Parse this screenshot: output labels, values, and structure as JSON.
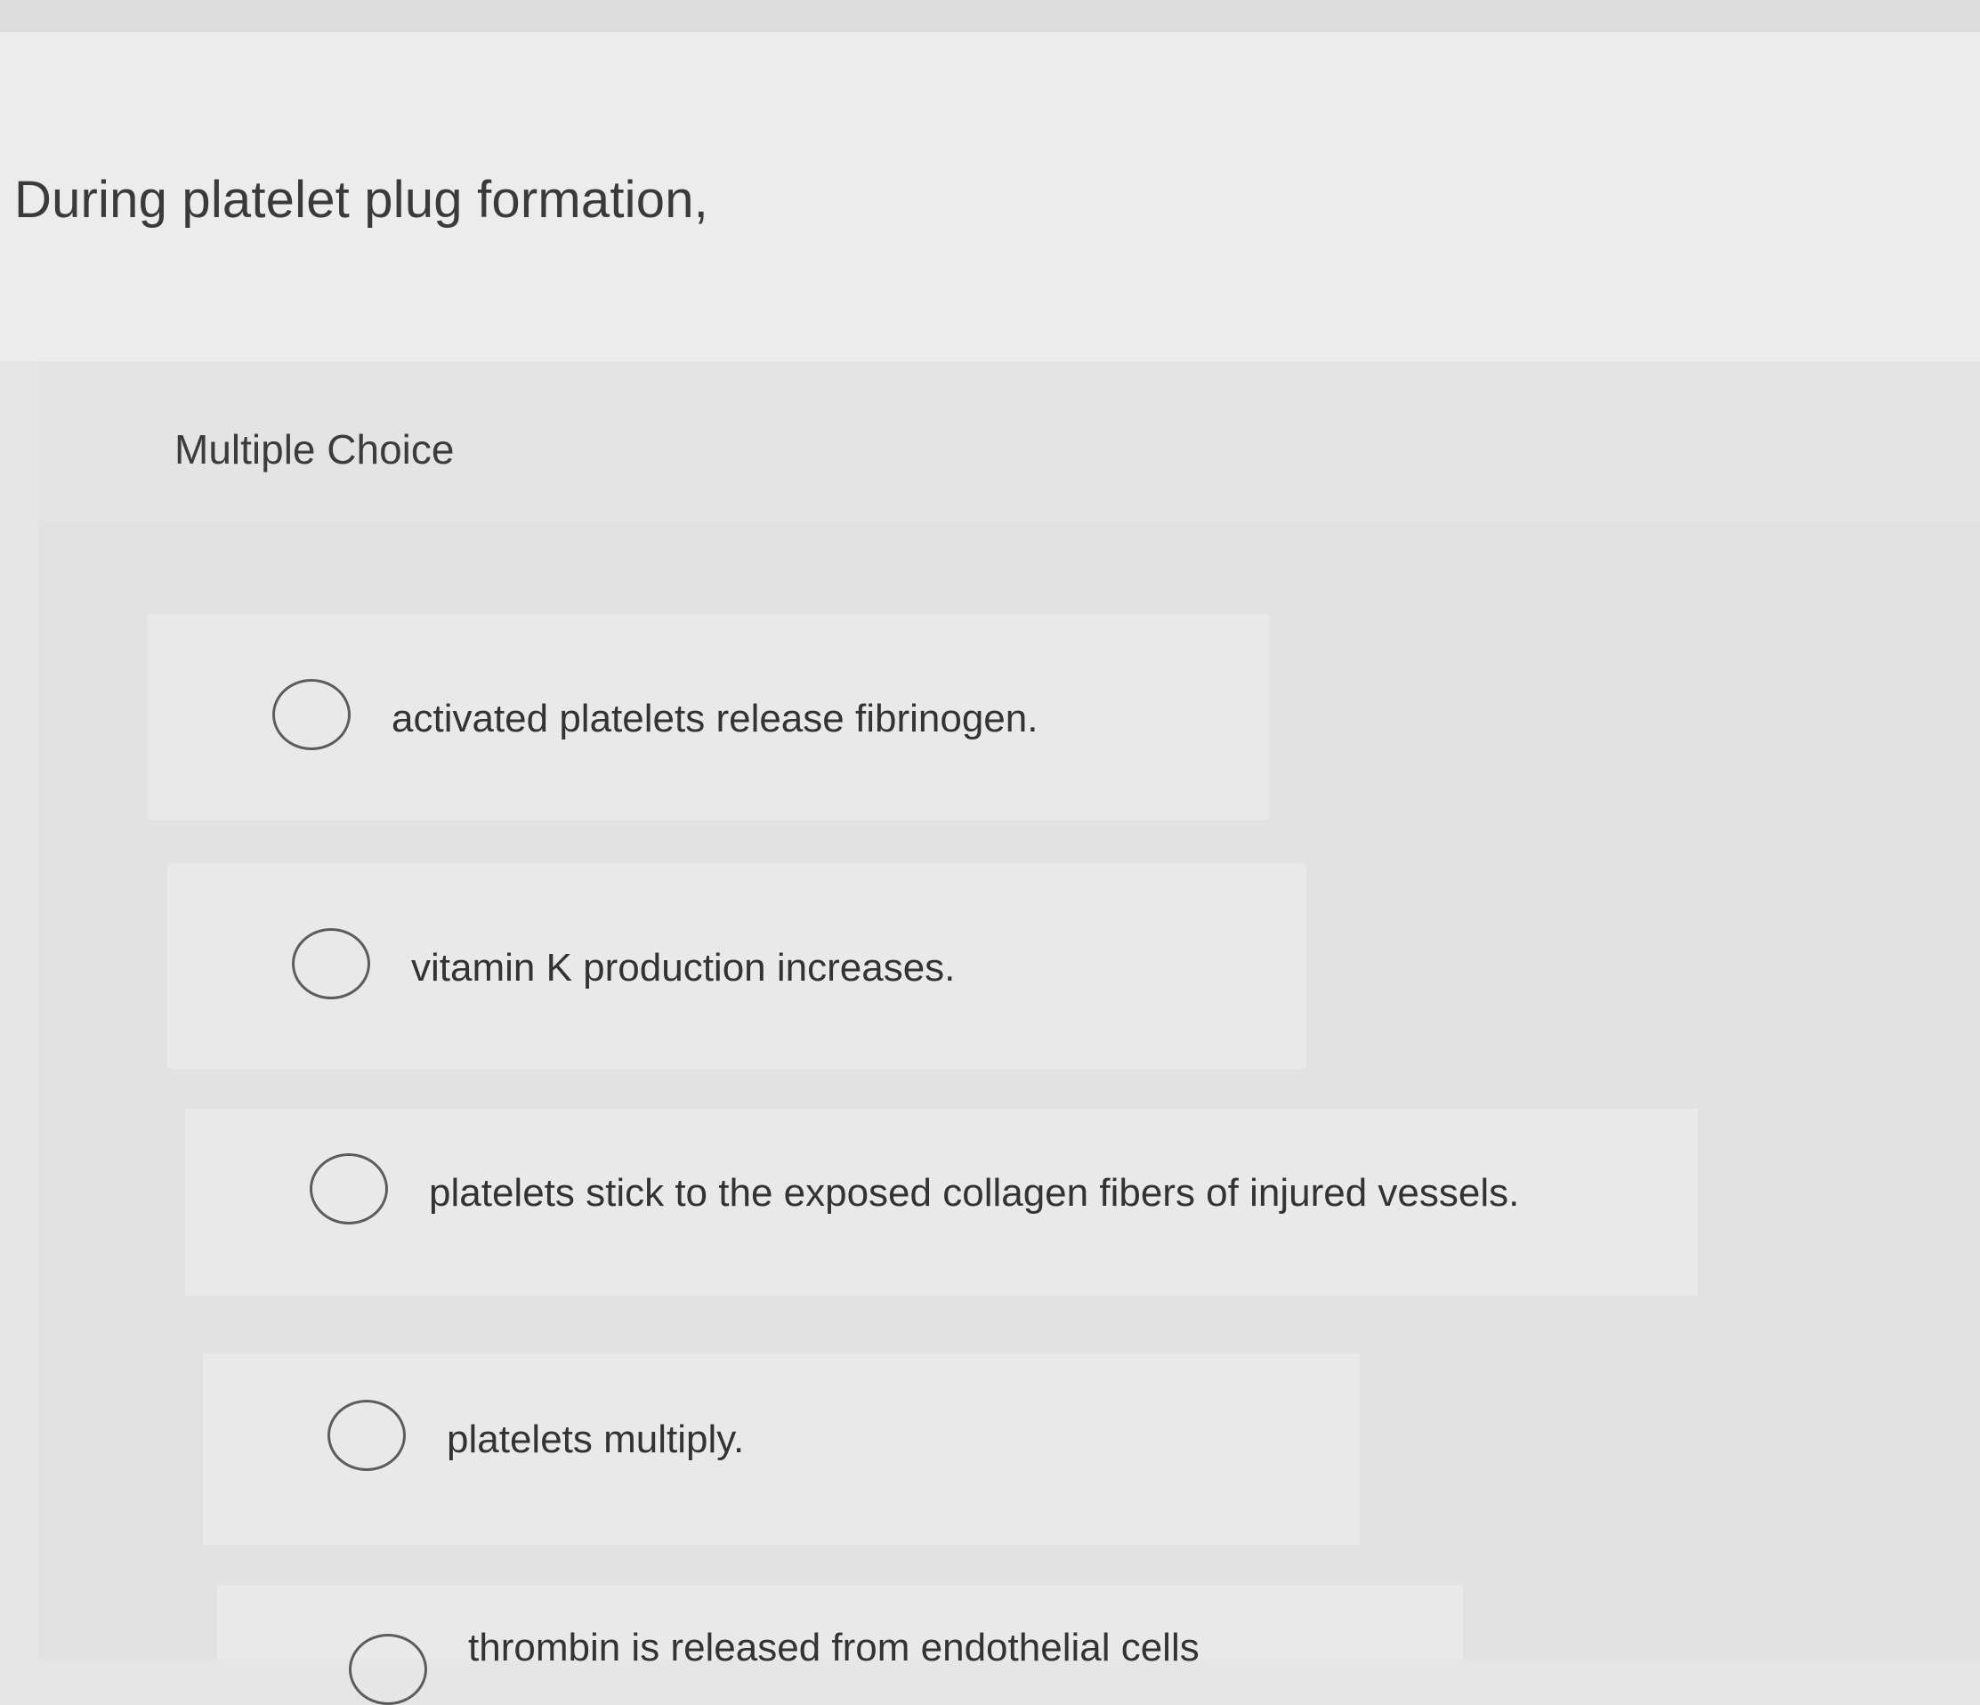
{
  "question": {
    "text": "During platelet plug formation,"
  },
  "multiple_choice": {
    "label": "Multiple Choice",
    "options": [
      {
        "label": "activated platelets release fibrinogen.",
        "selected": false
      },
      {
        "label": "vitamin K production increases.",
        "selected": false
      },
      {
        "label": "platelets stick to the exposed collagen fibers of injured vessels.",
        "selected": false
      },
      {
        "label": "platelets multiply.",
        "selected": false
      },
      {
        "label": "thrombin is released from endothelial cells",
        "selected": false
      }
    ]
  }
}
